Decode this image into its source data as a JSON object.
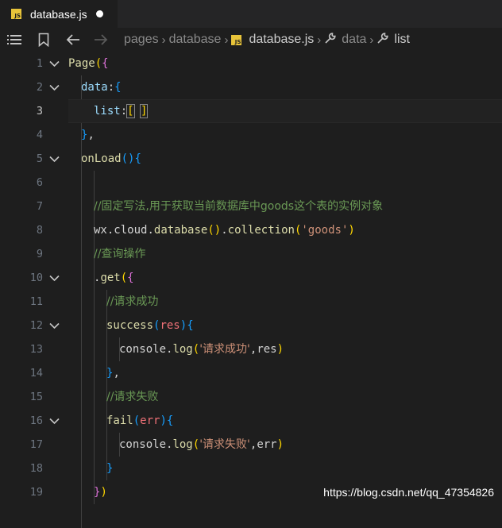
{
  "tab": {
    "filename": "database.js",
    "icon": "js-file-icon",
    "modified": true
  },
  "breadcrumb": {
    "items": [
      "pages",
      "database",
      "database.js",
      "data",
      "list"
    ],
    "icons": [
      "",
      "",
      "js-file-icon",
      "wrench-icon",
      "wrench-icon"
    ]
  },
  "editor": {
    "active_line": 3,
    "lines": [
      {
        "n": "1",
        "tokens": [
          [
            "Page",
            "fn"
          ],
          [
            "(",
            "b1"
          ],
          [
            "{",
            "b2"
          ]
        ]
      },
      {
        "n": "2",
        "tokens": [
          [
            "data",
            "prop"
          ],
          [
            ":",
            "plain"
          ],
          [
            "{",
            "b3"
          ]
        ]
      },
      {
        "n": "3",
        "tokens": [
          [
            "list",
            "prop"
          ],
          [
            ":",
            "plain"
          ],
          [
            "[",
            "b1"
          ],
          [
            " ",
            "plain"
          ],
          [
            "]",
            "b1"
          ]
        ]
      },
      {
        "n": "4",
        "tokens": [
          [
            "}",
            "b3"
          ],
          [
            ",",
            "plain"
          ]
        ]
      },
      {
        "n": "5",
        "tokens": [
          [
            "onLoad",
            "fn"
          ],
          [
            "(",
            "b3"
          ],
          [
            ")",
            "b3"
          ],
          [
            "{",
            "b3"
          ]
        ]
      },
      {
        "n": "6",
        "tokens": []
      },
      {
        "n": "7",
        "tokens": [
          [
            "//固定写法,用于获取当前数据库中goods这个表的实例对象",
            "com"
          ]
        ]
      },
      {
        "n": "8",
        "tokens": [
          [
            "wx",
            "plain"
          ],
          [
            ".",
            "plain"
          ],
          [
            "cloud",
            "plain"
          ],
          [
            ".",
            "plain"
          ],
          [
            "database",
            "fn"
          ],
          [
            "(",
            "b1"
          ],
          [
            ")",
            "b1"
          ],
          [
            ".",
            "plain"
          ],
          [
            "collection",
            "fn"
          ],
          [
            "(",
            "b1"
          ],
          [
            "'goods'",
            "str"
          ],
          [
            ")",
            "b1"
          ]
        ]
      },
      {
        "n": "9",
        "tokens": [
          [
            "//查询操作",
            "com"
          ]
        ]
      },
      {
        "n": "10",
        "tokens": [
          [
            ".",
            "plain"
          ],
          [
            "get",
            "fn"
          ],
          [
            "(",
            "b1"
          ],
          [
            "{",
            "b2"
          ]
        ]
      },
      {
        "n": "11",
        "tokens": [
          [
            "//请求成功",
            "com"
          ]
        ]
      },
      {
        "n": "12",
        "tokens": [
          [
            "success",
            "fn"
          ],
          [
            "(",
            "b3"
          ],
          [
            "res",
            "par"
          ],
          [
            ")",
            "b3"
          ],
          [
            "{",
            "b3"
          ]
        ]
      },
      {
        "n": "13",
        "tokens": [
          [
            "console",
            "plain"
          ],
          [
            ".",
            "plain"
          ],
          [
            "log",
            "fn"
          ],
          [
            "(",
            "b1"
          ],
          [
            "'请求成功'",
            "str"
          ],
          [
            ",",
            "plain"
          ],
          [
            "res",
            "plain"
          ],
          [
            ")",
            "b1"
          ]
        ]
      },
      {
        "n": "14",
        "tokens": [
          [
            "}",
            "b3"
          ],
          [
            ",",
            "plain"
          ]
        ]
      },
      {
        "n": "15",
        "tokens": [
          [
            "//请求失败",
            "com"
          ]
        ]
      },
      {
        "n": "16",
        "tokens": [
          [
            "fail",
            "fn"
          ],
          [
            "(",
            "b3"
          ],
          [
            "err",
            "par"
          ],
          [
            ")",
            "b3"
          ],
          [
            "{",
            "b3"
          ]
        ]
      },
      {
        "n": "17",
        "tokens": [
          [
            "console",
            "plain"
          ],
          [
            ".",
            "plain"
          ],
          [
            "log",
            "fn"
          ],
          [
            "(",
            "b1"
          ],
          [
            "'请求失败'",
            "str"
          ],
          [
            ",",
            "plain"
          ],
          [
            "err",
            "plain"
          ],
          [
            ")",
            "b1"
          ]
        ]
      },
      {
        "n": "18",
        "tokens": [
          [
            "}",
            "b3"
          ]
        ]
      },
      {
        "n": "19",
        "tokens": [
          [
            "}",
            "b2"
          ],
          [
            ")",
            "b1"
          ]
        ]
      },
      {
        "n": "",
        "tokens": []
      }
    ]
  },
  "watermark": "https://blog.csdn.net/qq_47354826",
  "colors": {
    "editor_bg": "#1e1e1e",
    "tab_bar_bg": "#252526",
    "js_icon": "#e8c43a"
  }
}
